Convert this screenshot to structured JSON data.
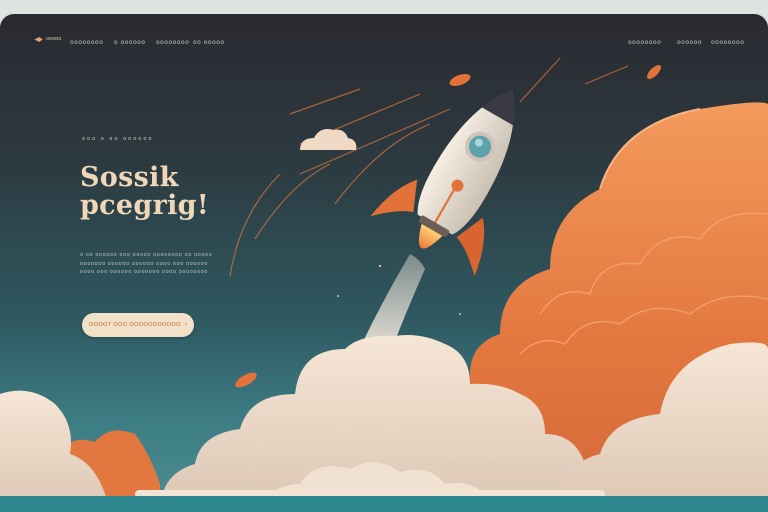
{
  "nav": {
    "logo_text": "ooooo",
    "left_items": [
      "oooooooo",
      "o oooooo",
      "oooooooo",
      "oo ooooo"
    ],
    "right_items": [
      "oooooooo",
      "oooooo",
      "oooooooo"
    ]
  },
  "hero": {
    "eyebrow": "ooo o oo oooooo",
    "title_line1": "Sossik",
    "title_line2": "pcegrig!",
    "body_lines": [
      "o oo oooooo ooo ooooo oooooooo oo ooooo",
      "ooooooo oooooo oooooo oooo ooo oooooo",
      "oooo ooo oooooo ooooooo oooo oooooooo"
    ],
    "cta_label": "OOOOT OOO OOOOOOOOOOO",
    "cta_arrow": "›"
  },
  "colors": {
    "accent": "#e2723a",
    "sky_top": "#2a2a30",
    "sky_bottom": "#4d8f93",
    "cloud_light": "#efdccd",
    "cloud_orange": "#e88548",
    "cta_bg": "#f1e1c9"
  },
  "icons": {
    "logo": "rocket-mark-icon",
    "cta": "arrow-right-icon"
  }
}
